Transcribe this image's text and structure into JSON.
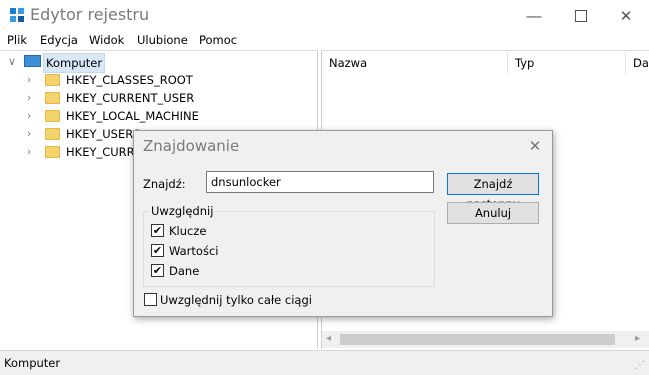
{
  "window": {
    "title": "Edytor rejestru"
  },
  "menu": [
    "Plik",
    "Edycja",
    "Widok",
    "Ulubione",
    "Pomoc"
  ],
  "tree": {
    "root": "Komputer",
    "keys": [
      "HKEY_CLASSES_ROOT",
      "HKEY_CURRENT_USER",
      "HKEY_LOCAL_MACHINE",
      "HKEY_USERS",
      "HKEY_CURRE"
    ]
  },
  "list": {
    "columns": [
      "Nazwa",
      "Typ",
      "Da"
    ]
  },
  "status": "Komputer",
  "dialog": {
    "title": "Znajdowanie",
    "find_label": "Znajdź:",
    "find_value": "dnsunlocker",
    "find_next_button": "Znajdź następny",
    "cancel_button": "Anuluj",
    "group_label": "Uwzględnij",
    "options": [
      {
        "label": "Klucze",
        "checked": true
      },
      {
        "label": "Wartości",
        "checked": true
      },
      {
        "label": "Dane",
        "checked": true
      }
    ],
    "whole_string": {
      "label": "Uwzględnij tylko całe ciągi",
      "checked": false
    }
  }
}
